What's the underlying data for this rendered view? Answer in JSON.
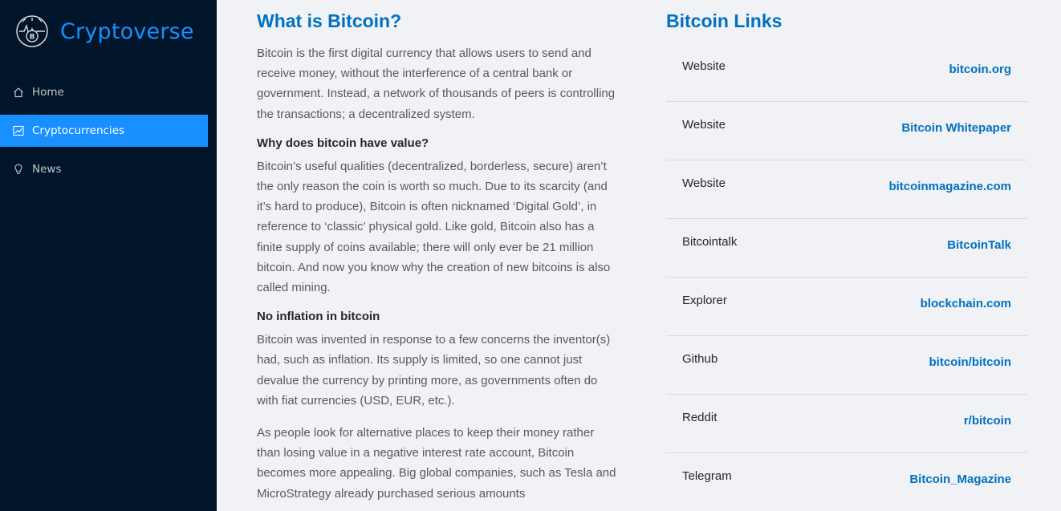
{
  "app": {
    "name": "Cryptoverse"
  },
  "sidebar": {
    "items": [
      {
        "label": "Home",
        "icon": "home-icon",
        "active": false
      },
      {
        "label": "Cryptocurrencies",
        "icon": "line-chart-icon",
        "active": true
      },
      {
        "label": "News",
        "icon": "bulb-icon",
        "active": false
      }
    ]
  },
  "about": {
    "title": "What is Bitcoin?",
    "intro": "Bitcoin is the first digital currency that allows users to send and receive money, without the interference of a central bank or government. Instead, a network of thousands of peers is controlling the transactions; a decentralized system.",
    "section1_title": "Why does bitcoin have value?",
    "section1_body": "Bitcoin’s useful qualities (decentralized, borderless, secure) aren’t the only reason the coin is worth so much. Due to its scarcity (and it’s hard to produce), Bitcoin is often nicknamed ‘Digital Gold’, in reference to ‘classic’ physical gold. Like gold, Bitcoin also has a finite supply of coins available; there will only ever be 21 million bitcoin. And now you know why the creation of new bitcoins is also called mining.",
    "section2_title": "No inflation in bitcoin",
    "section2_body": "Bitcoin was invented in response to a few concerns the inventor(s) had, such as inflation. Its supply is limited, so one cannot just devalue the currency by printing more, as governments often do with fiat currencies (USD, EUR, etc.).",
    "section2_body2": "As people look for alternative places to keep their money rather than losing value in a negative interest rate account, Bitcoin becomes more appealing. Big global companies, such as Tesla and MicroStrategy already purchased serious amounts"
  },
  "links": {
    "title": "Bitcoin Links",
    "rows": [
      {
        "name": "Website",
        "url": "bitcoin.org"
      },
      {
        "name": "Website",
        "url": "Bitcoin Whitepaper"
      },
      {
        "name": "Website",
        "url": "bitcoinmagazine.com"
      },
      {
        "name": "Bitcointalk",
        "url": "BitcoinTalk"
      },
      {
        "name": "Explorer",
        "url": "blockchain.com"
      },
      {
        "name": "Github",
        "url": "bitcoin/bitcoin"
      },
      {
        "name": "Reddit",
        "url": "r/bitcoin"
      },
      {
        "name": "Telegram",
        "url": "Bitcoin_Magazine"
      }
    ]
  },
  "colors": {
    "sidebar_bg": "#001529",
    "accent": "#1890ff",
    "link": "#0071c2",
    "page_bg": "#f0f2f5"
  }
}
